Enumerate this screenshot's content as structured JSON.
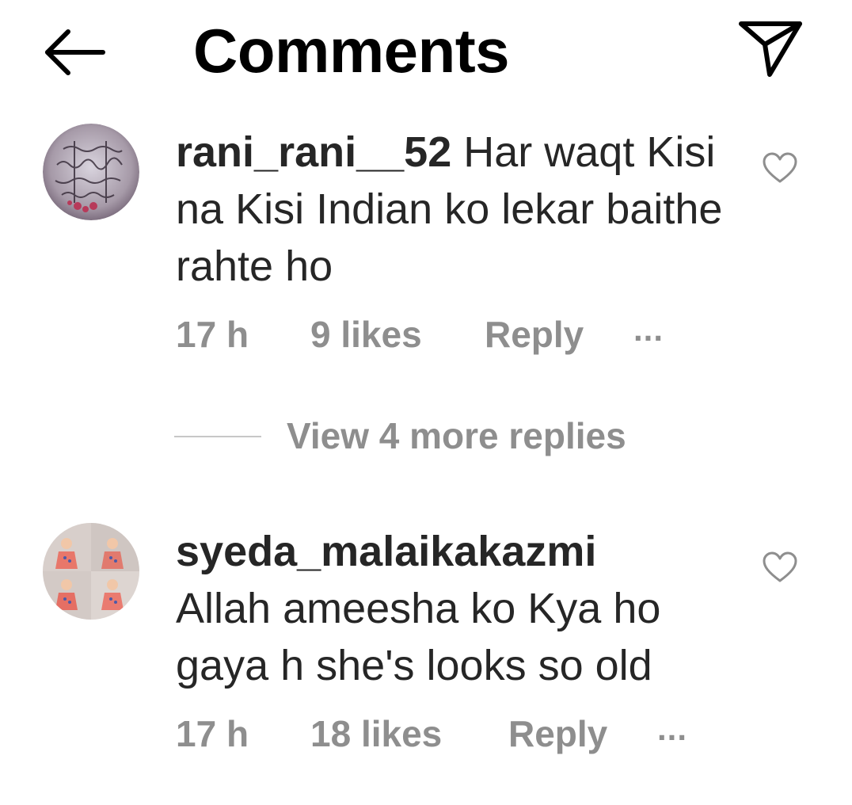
{
  "header": {
    "title": "Comments",
    "back_icon": "arrow-left-icon",
    "share_icon": "send-icon"
  },
  "comments": [
    {
      "username": "rani_rani__52",
      "text": "Har waqt Kisi na Kisi Indian ko lekar baithe rahte ho",
      "time": "17 h",
      "likes": "9 likes",
      "reply_label": "Reply",
      "more_label": "...",
      "view_replies": "View 4 more replies",
      "avatar_icon": "calligraphy-avatar",
      "like_icon": "heart-outline-icon"
    },
    {
      "username": "syeda_malaikakazmi",
      "text": "Allah ameesha ko Kya ho gaya h she's looks so old",
      "time": "17 h",
      "likes": "18 likes",
      "reply_label": "Reply",
      "more_label": "...",
      "avatar_icon": "baby-photo-avatar",
      "like_icon": "heart-outline-icon"
    }
  ],
  "colors": {
    "text_primary": "#262626",
    "text_secondary": "#8e8e8e",
    "divider": "#c7c7c7",
    "background": "#ffffff"
  }
}
